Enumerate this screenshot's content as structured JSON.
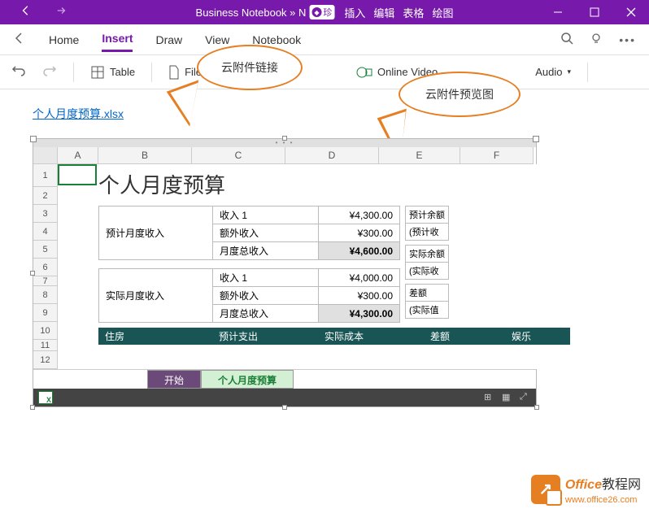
{
  "titlebar": {
    "title_prefix": "Business Notebook » N",
    "gem": "珍",
    "menu": [
      "插入",
      "编辑",
      "表格",
      "绘图"
    ]
  },
  "menubar": {
    "items": [
      "Home",
      "Insert",
      "Draw",
      "View",
      "Notebook"
    ],
    "active_index": 1
  },
  "ribbon": {
    "table": "Table",
    "file": "File",
    "online_video": "Online Video",
    "audio": "Audio"
  },
  "callouts": {
    "link_label": "云附件链接",
    "preview_label": "云附件预览图"
  },
  "attachment": {
    "filename": "个人月度预算.xlsx"
  },
  "spreadsheet": {
    "cols": [
      "",
      "A",
      "B",
      "C",
      "D",
      "E",
      "F"
    ],
    "rows": [
      "1",
      "2",
      "3",
      "4",
      "5",
      "6",
      "7",
      "8",
      "9",
      "10",
      "11",
      "12"
    ],
    "title": "个人月度预算",
    "section1": {
      "label": "预计月度收入",
      "rows": [
        {
          "cat": "收入 1",
          "val": "¥4,300.00"
        },
        {
          "cat": "额外收入",
          "val": "¥300.00"
        },
        {
          "cat": "月度总收入",
          "val": "¥4,600.00"
        }
      ],
      "side": [
        "预计余额",
        "(预计收"
      ]
    },
    "section2": {
      "label": "实际月度收入",
      "rows": [
        {
          "cat": "收入 1",
          "val": "¥4,000.00"
        },
        {
          "cat": "额外收入",
          "val": "¥300.00"
        },
        {
          "cat": "月度总收入",
          "val": "¥4,300.00"
        }
      ],
      "side": [
        "实际余额",
        "(实际收",
        "",
        "差额",
        "(实际值"
      ]
    },
    "dark_header": [
      "住房",
      "预计支出",
      "实际成本",
      "差额",
      "娱乐"
    ],
    "tabs": [
      "开始",
      "个人月度预算"
    ],
    "active_tab": 1
  },
  "watermark": {
    "brand": "Office",
    "suffix": "教程网",
    "url": "www.office26.com"
  }
}
